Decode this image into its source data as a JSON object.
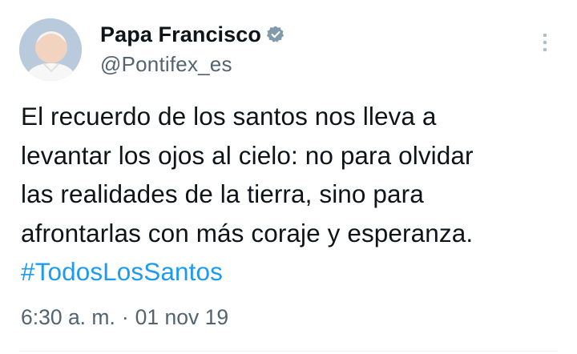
{
  "author": {
    "display_name": "Papa Francisco",
    "handle": "@Pontifex_es",
    "verified_icon": "verified-badge-icon",
    "verified_color": "#829aab"
  },
  "menu_icon": "more-vertical-icon",
  "tweet": {
    "lines": [
      "El recuerdo de los santos nos lleva a",
      "levantar los ojos al cielo: no para olvidar",
      "las realidades de la tierra, sino para",
      "afrontarlas con más coraje y esperanza."
    ],
    "hashtag": "#TodosLosSantos",
    "hashtag_color": "#1d9bf0"
  },
  "meta": {
    "time": "6:30 a. m.",
    "separator": "·",
    "date": "01 nov 19"
  }
}
